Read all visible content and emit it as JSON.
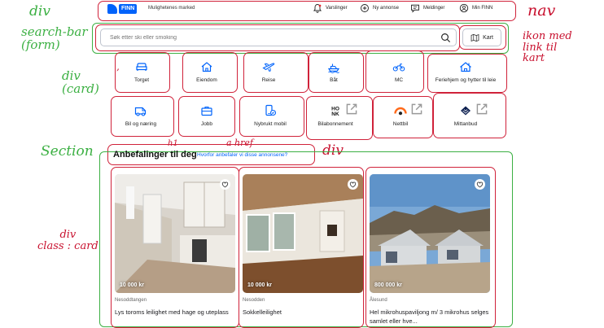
{
  "annotations": {
    "div_nav": "div",
    "search_bar": "search-bar\n(form)",
    "div_card": "div\n(card)",
    "section": "Section",
    "div_class_card": "div\nclass : card",
    "nav": "nav",
    "ikon_kart": "ikon med\nlink til\nkart",
    "div_rec": "div",
    "a_href": "a href",
    "h1": "h1",
    "comma": ","
  },
  "nav": {
    "logo": "FINN",
    "tagline": "Mulighetenes marked",
    "items": [
      {
        "label": "Varslinger",
        "icon": "bell-icon"
      },
      {
        "label": "Ny annonse",
        "icon": "plus-circle-icon"
      },
      {
        "label": "Meldinger",
        "icon": "chat-icon"
      },
      {
        "label": "Min FINN",
        "icon": "user-icon"
      }
    ]
  },
  "search": {
    "placeholder": "Søk etter ski eller smoking",
    "map_button": "Kart"
  },
  "categories": [
    {
      "label": "Torget",
      "icon": "sofa-icon"
    },
    {
      "label": "Eiendom",
      "icon": "house-icon"
    },
    {
      "label": "Reise",
      "icon": "plane-icon"
    },
    {
      "label": "Båt",
      "icon": "boat-icon"
    },
    {
      "label": "MC",
      "icon": "motorcycle-icon"
    },
    {
      "label": "Feriehjem og hytter til leie",
      "icon": "cabin-icon"
    },
    {
      "label": "Bil og næring",
      "icon": "van-icon"
    },
    {
      "label": "Jobb",
      "icon": "briefcase-icon"
    },
    {
      "label": "Nybrukt mobil",
      "icon": "phone-icon"
    },
    {
      "label": "Bilabonnement",
      "icon": "honk-logo"
    },
    {
      "label": "Nettbil",
      "icon": "nettbil-logo"
    },
    {
      "label": "Mittanbud",
      "icon": "mittanbud-logo"
    }
  ],
  "recommendations": {
    "title": "Anbefalinger til deg",
    "link": "Hvorfor anbefaler vi disse annonsene?",
    "ads": [
      {
        "price": "10 000 kr",
        "location": "Nesoddtangen",
        "title": "Lys toroms leilighet med hage og uteplass"
      },
      {
        "price": "10 000 kr",
        "location": "Nesodden",
        "title": "Sokkelleilighet"
      },
      {
        "price": "800 000 kr",
        "location": "Ålesund",
        "title": "Hel mikrohuspaviljong m/ 3 mikrohus selges samlet eller hve..."
      }
    ]
  },
  "colors": {
    "brand": "#0063fb",
    "annotation_red": "#d0223a",
    "annotation_green": "#3cb043"
  }
}
